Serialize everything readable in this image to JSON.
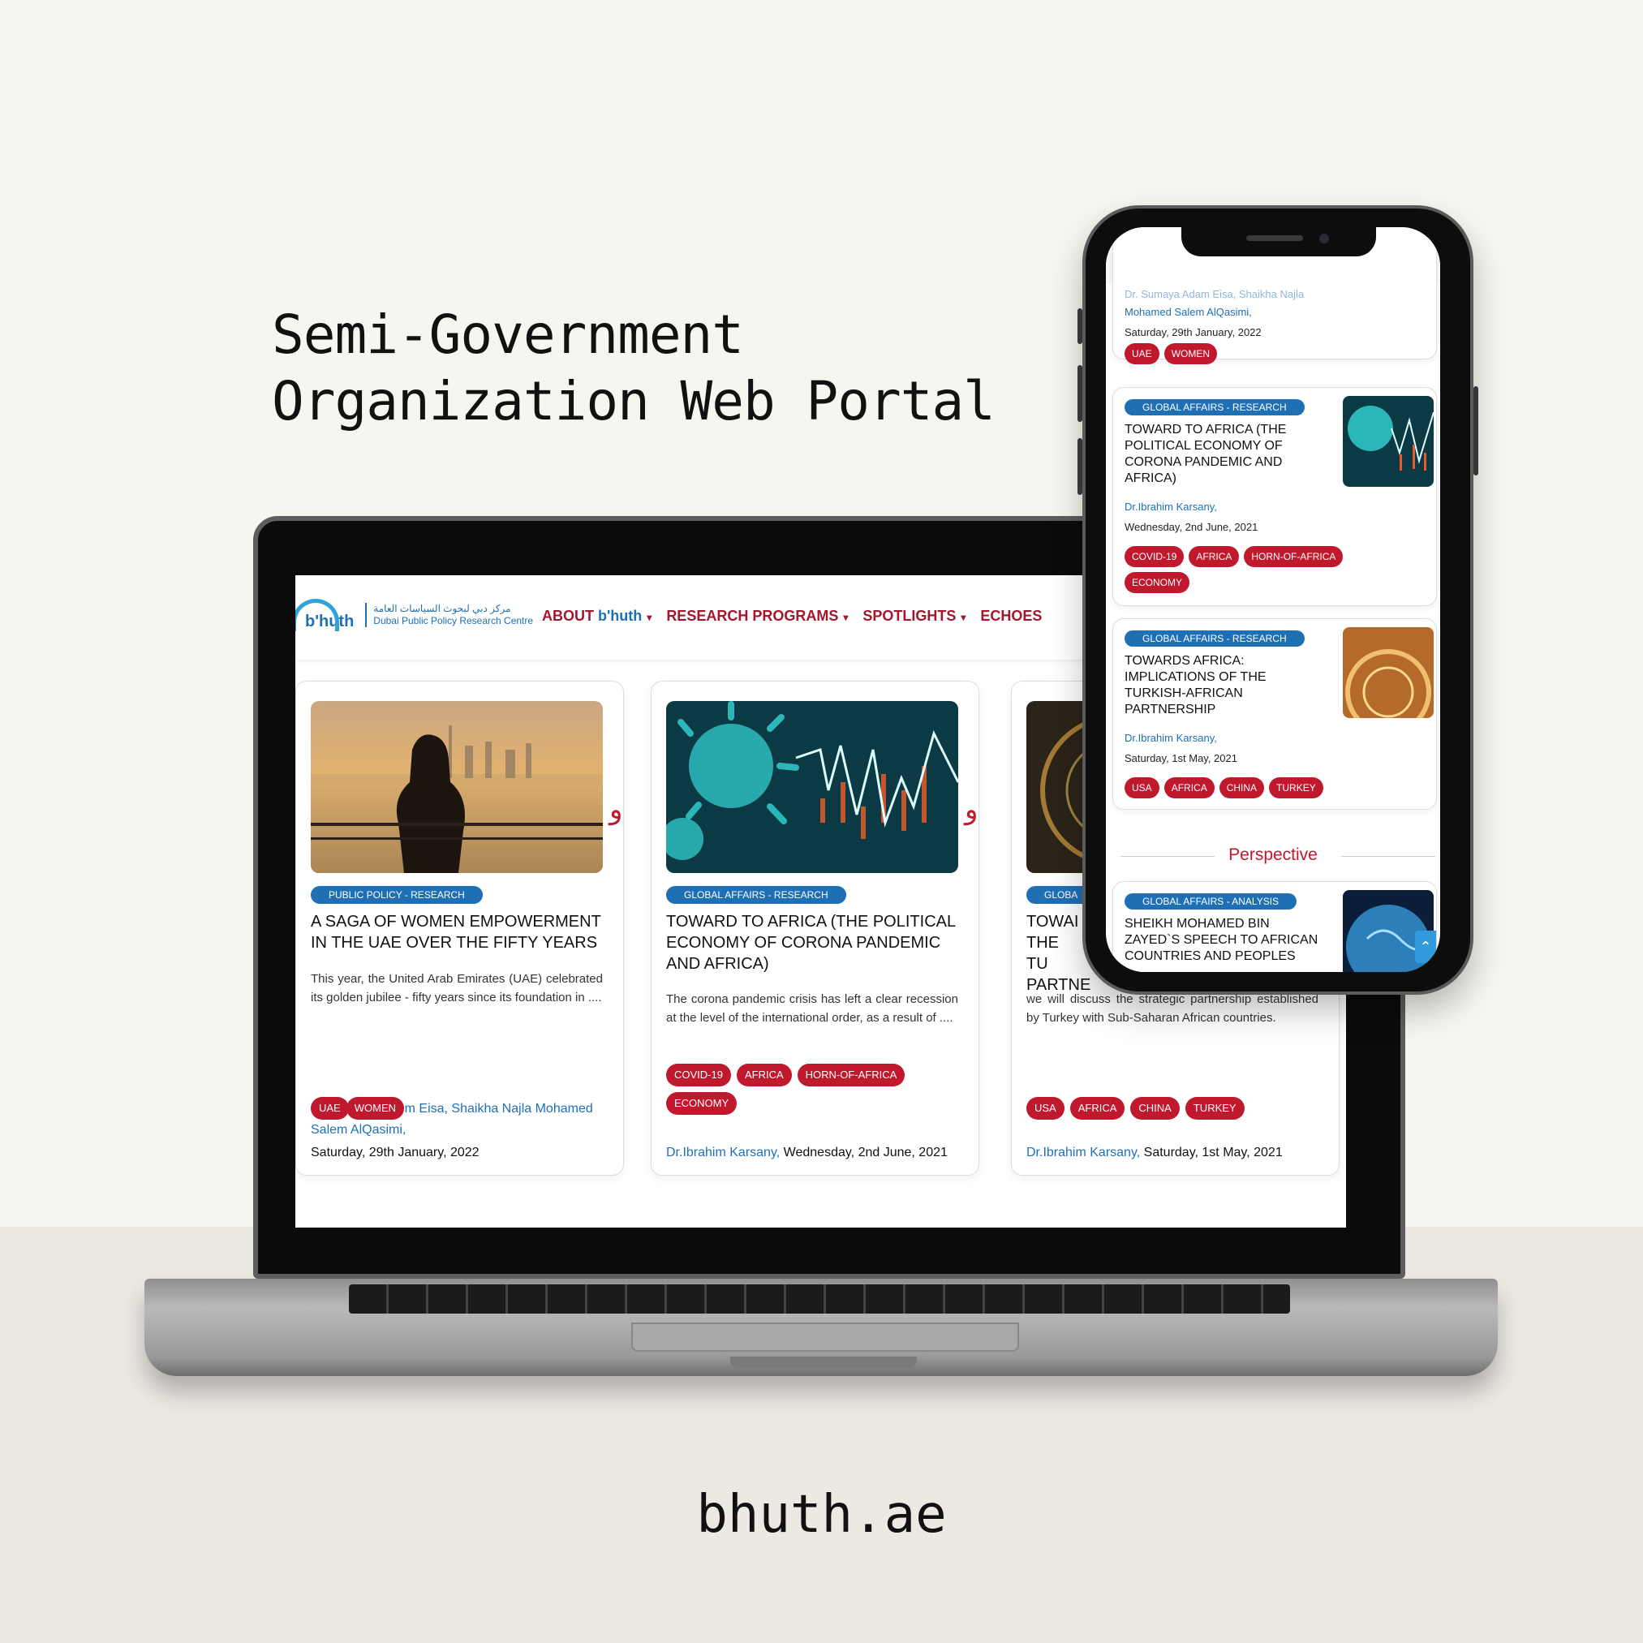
{
  "headline": {
    "line1": "Semi-Government",
    "line2": "Organization Web Portal"
  },
  "footer_url": "bhuth.ae",
  "logo": {
    "word": "b'huth",
    "arabic": "مركز دبي لبحوث السياسات العامة",
    "english": "Dubai Public Policy Research Centre"
  },
  "nav": {
    "about_prefix": "ABOUT",
    "about_brand": "b'huth",
    "research": "RESEARCH PROGRAMS",
    "spotlights": "SPOTLIGHTS",
    "echoes": "ECHOES"
  },
  "arabic_mark": "و",
  "cards": [
    {
      "category": "PUBLIC POLICY - RESEARCH",
      "title": "A SAGA OF WOMEN EMPOWERMENT IN THE UAE OVER THE FIFTY YEARS",
      "description": "This year, the United Arab Emirates (UAE) celebrated its golden jubilee - fifty years since its foundation in ....",
      "tags": [
        "UAE",
        "WOMEN"
      ],
      "author": "Dr. Sumaya Adam Eisa, Shaikha Najla Mohamed Salem AlQasimi,",
      "author_visible": "m Eisa, Shaikha Najla Mohamed Salem AlQasimi,",
      "date": "Saturday, 29th January, 2022"
    },
    {
      "category": "GLOBAL AFFAIRS - RESEARCH",
      "title": "TOWARD TO AFRICA (THE POLITICAL ECONOMY OF CORONA PANDEMIC AND AFRICA)",
      "description": "The corona pandemic crisis has left a clear recession at the level of the international order, as a result of ....",
      "tags": [
        "COVID-19",
        "AFRICA",
        "HORN-OF-AFRICA",
        "ECONOMY"
      ],
      "author": "Dr.Ibrahim Karsany,",
      "date": "Wednesday, 2nd June, 2021"
    },
    {
      "category": "GLOBA",
      "title": "TOWAI THE TU PARTNE",
      "description": "we will discuss the strategic partnership established by Turkey with Sub-Saharan African countries.",
      "tags": [
        "USA",
        "AFRICA",
        "CHINA",
        "TURKEY"
      ],
      "author": "Dr.Ibrahim Karsany,",
      "date": "Saturday, 1st May, 2021"
    }
  ],
  "phone": {
    "partial_author": "Dr. Sumaya Adam Eisa, Shaikha Najla",
    "partial_author2": "Mohamed Salem AlQasimi,",
    "partial_date": "Saturday, 29th January, 2022",
    "partial_tags": [
      "UAE",
      "WOMEN"
    ],
    "cards": [
      {
        "category": "GLOBAL AFFAIRS - RESEARCH",
        "title": "TOWARD TO AFRICA (THE POLITICAL ECONOMY OF CORONA PANDEMIC AND AFRICA)",
        "author": "Dr.Ibrahim Karsany,",
        "date": "Wednesday, 2nd June, 2021",
        "tags": [
          "COVID-19",
          "AFRICA",
          "HORN-OF-AFRICA",
          "ECONOMY"
        ]
      },
      {
        "category": "GLOBAL AFFAIRS - RESEARCH",
        "title": "TOWARDS AFRICA: IMPLICATIONS OF THE TURKISH-AFRICAN PARTNERSHIP",
        "author": "Dr.Ibrahim Karsany,",
        "date": "Saturday, 1st May, 2021",
        "tags": [
          "USA",
          "AFRICA",
          "CHINA",
          "TURKEY"
        ]
      }
    ],
    "section_title": "Perspective",
    "analysis_card": {
      "category": "GLOBAL AFFAIRS - ANALYSIS",
      "title": "SHEIKH MOHAMED BIN ZAYED`S SPEECH TO AFRICAN COUNTRIES AND PEOPLES"
    }
  },
  "colors": {
    "brand_red": "#c0182c",
    "brand_blue": "#1f6fb5",
    "nav_red": "#a3162c"
  }
}
